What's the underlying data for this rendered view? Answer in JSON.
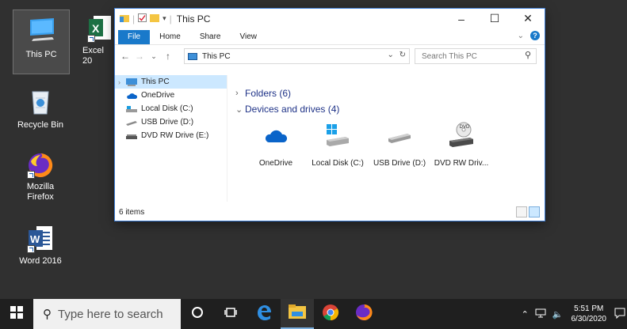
{
  "desktop": {
    "icons": [
      {
        "label": "This PC"
      },
      {
        "label": "Excel 20"
      },
      {
        "label": "Recycle Bin"
      },
      {
        "label": "Mozilla Firefox"
      },
      {
        "label": "Word 2016"
      }
    ]
  },
  "explorer": {
    "title": "This PC",
    "ribbon_tabs": [
      "File",
      "Home",
      "Share",
      "View"
    ],
    "address": "This PC",
    "search_placeholder": "Search This PC",
    "nav_items": [
      "This PC",
      "OneDrive",
      "Local Disk (C:)",
      "USB Drive (D:)",
      "DVD RW Drive (E:)"
    ],
    "groups": {
      "folders": "Folders (6)",
      "devices": "Devices and drives (4)"
    },
    "drives": [
      "OneDrive",
      "Local Disk (C:)",
      "USB Drive (D:)",
      "DVD RW Driv..."
    ],
    "status": "6 items",
    "dvd_badge": "DVD"
  },
  "taskbar": {
    "search_placeholder": "Type here to search",
    "time": "5:51 PM",
    "date": "6/30/2020"
  },
  "colors": {
    "accent": "#1979ca",
    "selection": "#cce8ff",
    "desktop": "#303030",
    "taskbar": "#1f1f1f"
  }
}
